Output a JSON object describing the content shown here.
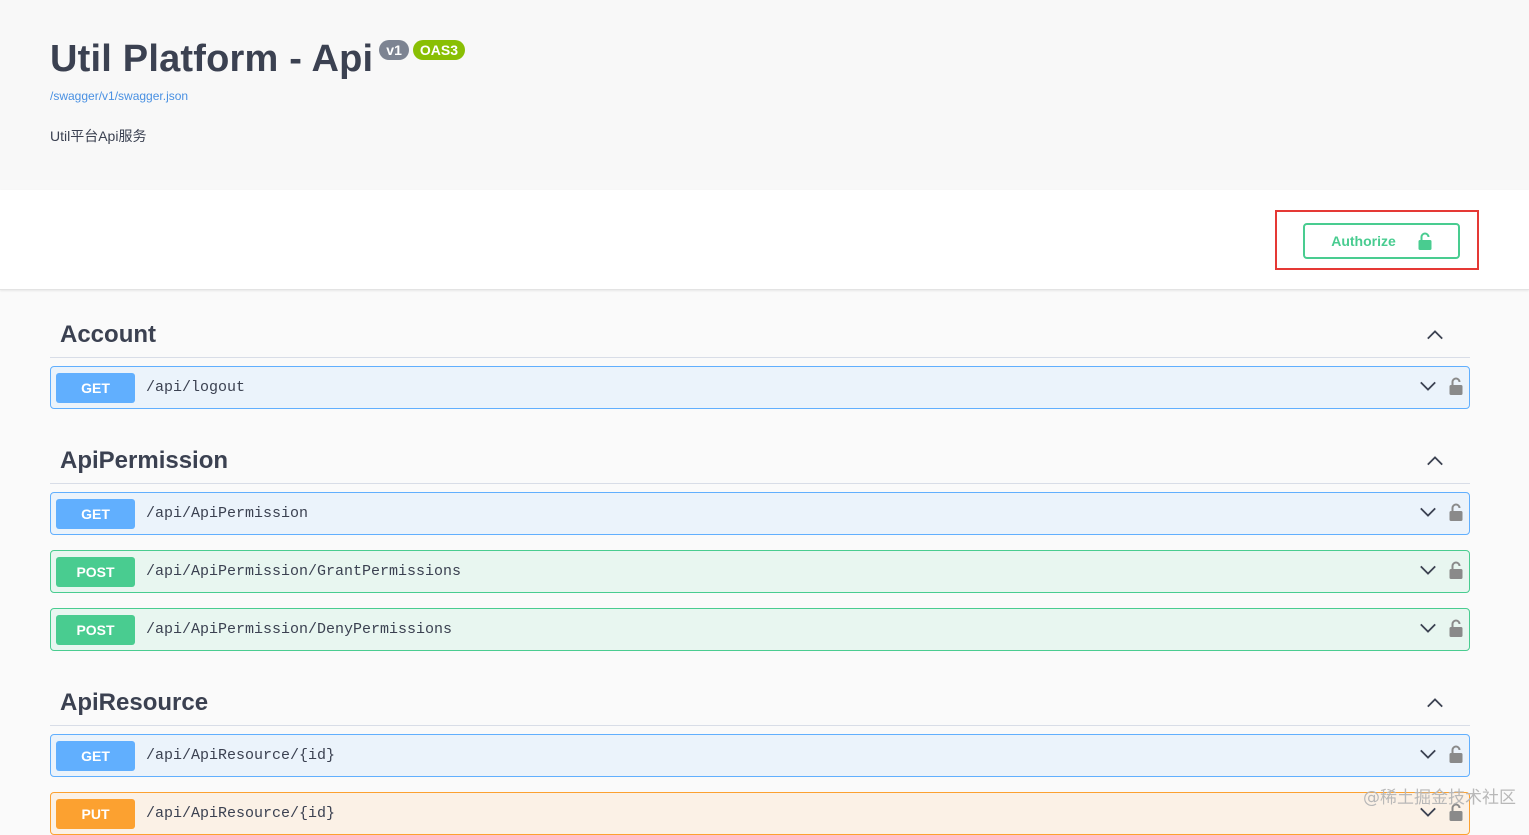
{
  "info": {
    "title": "Util Platform - Api",
    "version_badge": "v1",
    "oas_badge": "OAS3",
    "spec_link": "/swagger/v1/swagger.json",
    "description": "Util平台Api服务"
  },
  "auth": {
    "label": "Authorize",
    "icon": "unlocked-padlock-icon",
    "color": "#49cc90",
    "highlight_color": "#e53935"
  },
  "colors": {
    "get": "#61affe",
    "post": "#49cc90",
    "put": "#fca130"
  },
  "sections": [
    {
      "name": "Account",
      "operations": [
        {
          "method": "GET",
          "path": "/api/logout"
        }
      ]
    },
    {
      "name": "ApiPermission",
      "operations": [
        {
          "method": "GET",
          "path": "/api/ApiPermission"
        },
        {
          "method": "POST",
          "path": "/api/ApiPermission/GrantPermissions"
        },
        {
          "method": "POST",
          "path": "/api/ApiPermission/DenyPermissions"
        }
      ]
    },
    {
      "name": "ApiResource",
      "operations": [
        {
          "method": "GET",
          "path": "/api/ApiResource/{id}"
        },
        {
          "method": "PUT",
          "path": "/api/ApiResource/{id}"
        }
      ]
    }
  ],
  "watermark": "@稀土掘金技术社区"
}
